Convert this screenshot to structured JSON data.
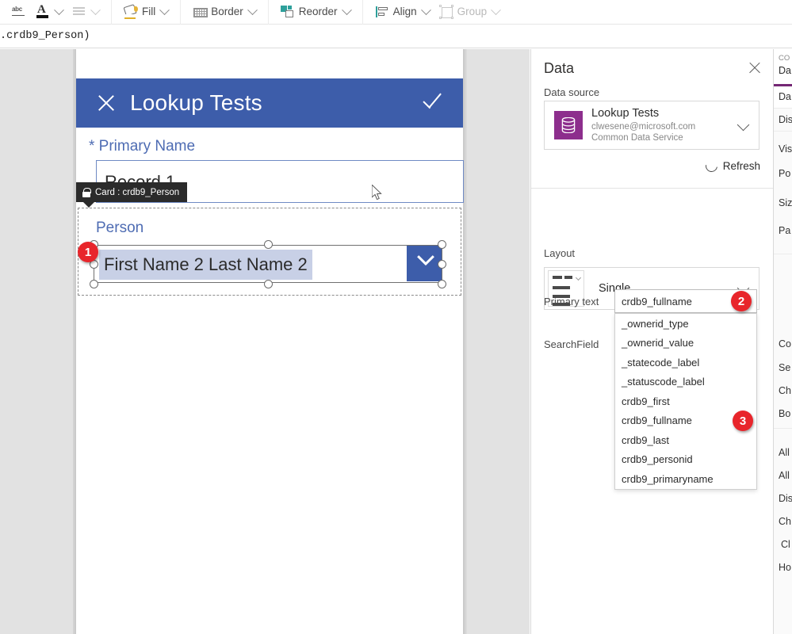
{
  "toolbar": {
    "items": [
      {
        "icon": "spellcheck-icon",
        "label": "",
        "disabled": false,
        "has_chevron": false
      },
      {
        "icon": "font-color-icon",
        "label": "",
        "disabled": false,
        "has_chevron": true
      },
      {
        "icon": "text-align-icon",
        "label": "",
        "disabled": true,
        "has_chevron": true
      },
      {
        "icon": "fill-bucket-icon",
        "label": "Fill",
        "disabled": false,
        "has_chevron": true
      },
      {
        "icon": "border-grid-icon",
        "label": "Border",
        "disabled": false,
        "has_chevron": true
      },
      {
        "icon": "reorder-icon",
        "label": "Reorder",
        "disabled": false,
        "has_chevron": true
      },
      {
        "icon": "align-icon",
        "label": "Align",
        "disabled": false,
        "has_chevron": true
      },
      {
        "icon": "group-icon",
        "label": "Group",
        "disabled": true,
        "has_chevron": true
      }
    ]
  },
  "formula_bar": {
    "text": ".crdb9_Person)"
  },
  "canvas": {
    "app_header": {
      "close_icon": "close-icon",
      "title": "Lookup Tests",
      "confirm_icon": "checkmark-icon"
    },
    "primary_name": {
      "label": "* Primary Name",
      "value": "Record 1"
    },
    "tooltip": {
      "icon": "lock-icon",
      "text": "Card : crdb9_Person"
    },
    "person_card": {
      "label": "Person",
      "combo_value": "First Name 2 Last Name 2",
      "dropdown_icon": "chevron-down-icon"
    }
  },
  "annotations": [
    {
      "number": "1"
    },
    {
      "number": "2"
    },
    {
      "number": "3"
    }
  ],
  "data_panel": {
    "title": "Data",
    "close_icon": "close-icon",
    "data_source_label": "Data source",
    "data_source": {
      "icon": "database-icon",
      "name": "Lookup Tests",
      "account": "clwesene@microsoft.com",
      "connector": "Common Data Service",
      "expand_icon": "chevron-down-icon"
    },
    "refresh": {
      "icon": "refresh-icon",
      "label": "Refresh"
    },
    "layout_label": "Layout",
    "layout": {
      "thumbnail_icon": "single-layout-icon",
      "value": "Single",
      "expand_icon": "chevron-down-icon"
    },
    "primary_text": {
      "label": "Primary text",
      "value": "crdb9_fullname"
    },
    "search_field": {
      "label": "SearchField"
    },
    "dropdown_options": [
      "_ownerid_type",
      "_ownerid_value",
      "_statecode_label",
      "_statuscode_label",
      "crdb9_first",
      "crdb9_fullname",
      "crdb9_last",
      "crdb9_personid",
      "crdb9_primaryname"
    ]
  },
  "right_strip": {
    "tab_head": "CO",
    "tab_label": "Da",
    "rows": [
      "Da",
      "Dis",
      "Vis",
      "Po",
      "Siz",
      "Pa",
      "Co",
      "Se",
      "Ch",
      "Bo",
      "All",
      "All",
      "Dis",
      "Ch",
      "Cl",
      "Ho"
    ]
  },
  "colors": {
    "header_blue": "#3d5daa",
    "label_blue": "#4e6cb3",
    "badge_red": "#e8252b",
    "source_purple": "#8d2e8d",
    "accent_purple": "#742774",
    "canvas_gray": "#e2e2e2"
  }
}
